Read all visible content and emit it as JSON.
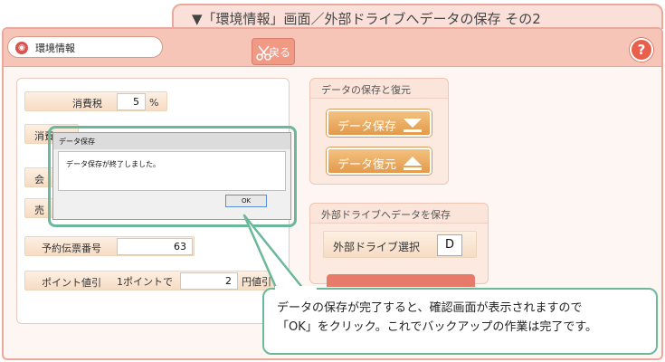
{
  "caption": "▼「環境情報」画面／外部ドライブへデータの保存 その2",
  "header": {
    "title": "環境情報",
    "back_label": "戻る",
    "help_label": "?"
  },
  "form": {
    "tax_label": "消費税",
    "tax_value": "5",
    "tax_unit": "%",
    "row2_label_partial": "消費",
    "row3_label_partial": "会",
    "row4_label_partial": "売",
    "reservation_label": "予約伝票番号",
    "reservation_value": "63",
    "points_label": "ポイント値引",
    "points_per_label": "1ポイントで",
    "points_value": "2",
    "points_unit": "円値引"
  },
  "save_restore": {
    "title": "データの保存と復元",
    "save_label": "データ保存",
    "restore_label": "データ復元"
  },
  "external": {
    "title": "外部ドライブへデータを保存",
    "drive_select_label": "外部ドライブ選択",
    "drive_value": "D"
  },
  "dialog": {
    "title": "データ保存",
    "message": "データ保存が終了しました。",
    "ok_label": "OK"
  },
  "callout": {
    "line1": "データの保存が完了すると、確認画面が表示されますので",
    "line2": "「OK」をクリック。これでバックアップの作業は完了です。"
  }
}
